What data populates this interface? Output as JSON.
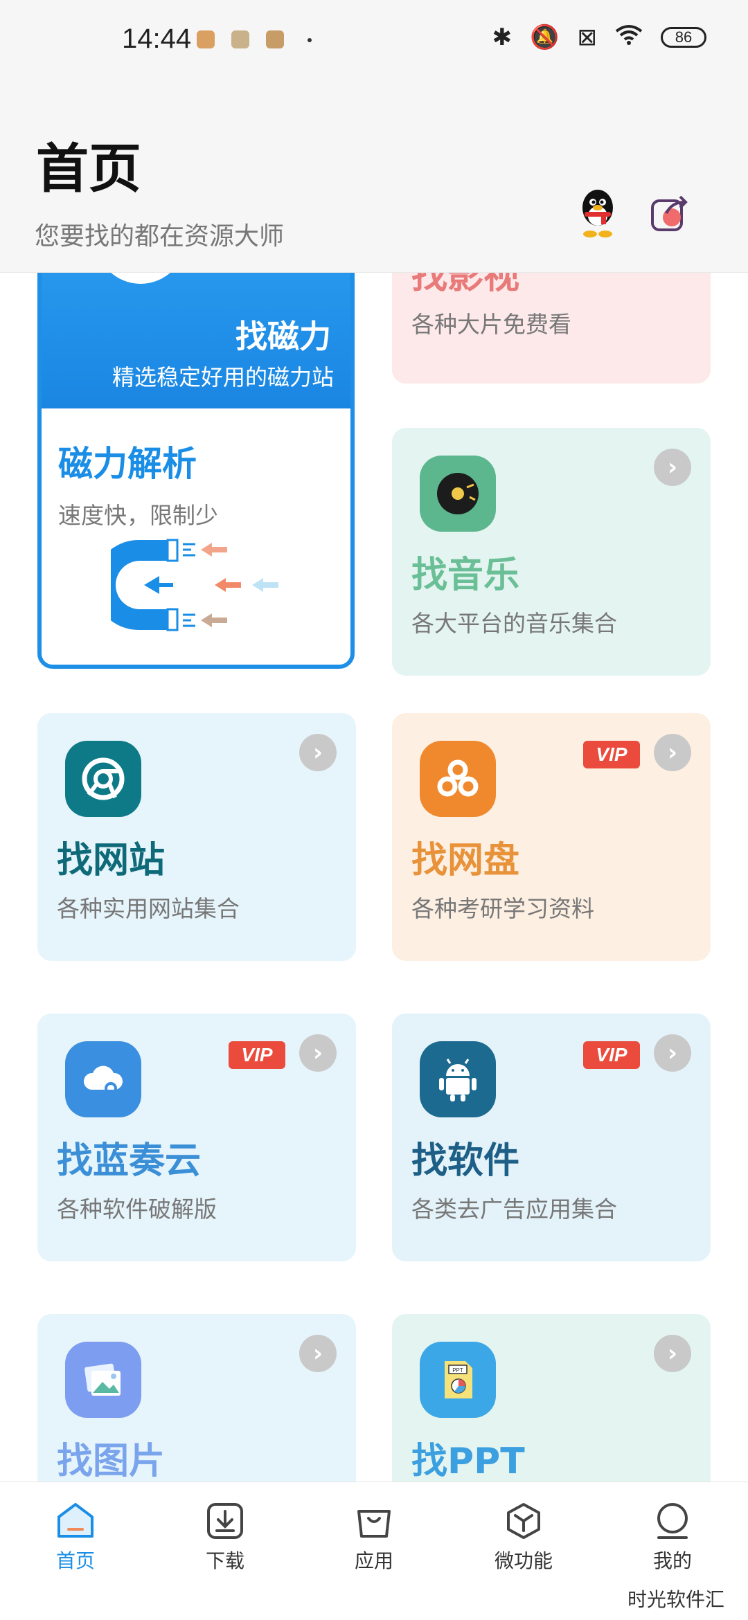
{
  "status_bar": {
    "time": "14:44",
    "battery": "86"
  },
  "header": {
    "title": "首页",
    "subtitle": "您要找的都在资源大师"
  },
  "magnet_card": {
    "title": "找磁力",
    "desc": "精选稳定好用的磁力站",
    "parse_title": "磁力解析",
    "parse_desc": "速度快，限制少"
  },
  "cards": {
    "video": {
      "title": "找影视",
      "desc": "各种大片免费看",
      "color": "#e87a7a"
    },
    "music": {
      "title": "找音乐",
      "desc": "各大平台的音乐集合",
      "color": "#6bbf97"
    },
    "site": {
      "title": "找网站",
      "desc": "各种实用网站集合",
      "color": "#0e6a79"
    },
    "disk": {
      "title": "找网盘",
      "desc": "各种考研学习资料",
      "color": "#e8923a",
      "badge": "VIP"
    },
    "lanzou": {
      "title": "找蓝奏云",
      "desc": "各种软件破解版",
      "color": "#3a8fd6",
      "badge": "VIP"
    },
    "software": {
      "title": "找软件",
      "desc": "各类去广告应用集合",
      "color": "#1d5f86",
      "badge": "VIP"
    },
    "picture": {
      "title": "找图片",
      "color": "#7aa4ec"
    },
    "ppt": {
      "title": "找PPT",
      "color": "#3b9fe0",
      "icon_text": "PPT"
    }
  },
  "bottom_nav": {
    "items": [
      {
        "label": "首页",
        "active": true
      },
      {
        "label": "下载"
      },
      {
        "label": "应用"
      },
      {
        "label": "微功能"
      },
      {
        "label": "我的"
      }
    ],
    "watermark": "时光软件汇"
  }
}
